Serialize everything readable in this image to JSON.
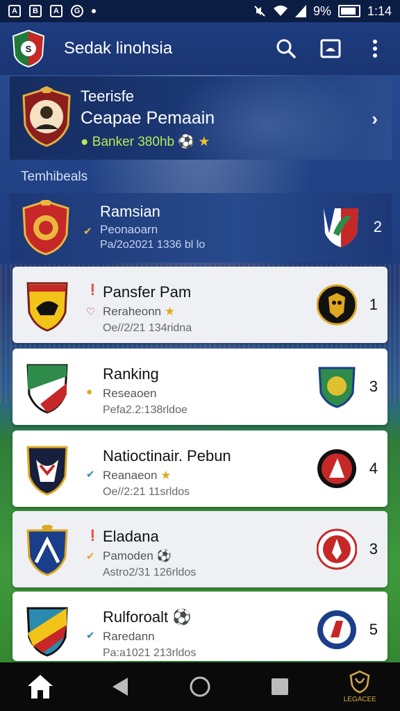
{
  "status_bar": {
    "battery": "9%",
    "time": "1:14",
    "icons": [
      "app-a-icon",
      "app-b-icon",
      "app-c-icon",
      "app-d-icon",
      "dot-icon",
      "mute-icon",
      "wifi-icon",
      "signal-icon",
      "battery-icon"
    ]
  },
  "app_bar": {
    "title": "Sedak linohsia",
    "icons": [
      "search-icon",
      "screen-icon",
      "more-vert-icon"
    ]
  },
  "featured": {
    "line1": "Teerisfe",
    "line2": "Ceapae Pemaain",
    "line3": "Banker 380hb",
    "chevron": "›"
  },
  "section": {
    "label": "Temhibeals"
  },
  "rows": [
    {
      "title": "Ramsian",
      "subtitle": "Peonaoarn",
      "date": "Pa/2o2021 1336 bl lo",
      "number": "2",
      "variant": "top"
    },
    {
      "title": "Pansfer Pam",
      "subtitle": "Reraheonn",
      "date": "Oe//2/21 134ridna",
      "number": "1",
      "variant": "alt"
    },
    {
      "title": "Ranking",
      "subtitle": "Reseaoen",
      "date": "Pefa2.2:138rldoe",
      "number": "3",
      "variant": "plain"
    },
    {
      "title": "Natioctinair. Pebun",
      "subtitle": "Reanaeon",
      "date": "Oe//2:21 11srldos",
      "number": "4",
      "variant": "plain"
    },
    {
      "title": "Eladana",
      "subtitle": "Pamoden",
      "date": "Astro2/31 126rldos",
      "number": "3",
      "variant": "alt"
    },
    {
      "title": "Rulforoalt",
      "subtitle": "Raredann",
      "date": "Pa:a1021 213rldos",
      "number": "5",
      "variant": "plain"
    }
  ],
  "nav": {
    "brand_label": "LEGACEE",
    "icons": [
      "home-icon",
      "back-icon",
      "home-circle-icon",
      "recents-icon",
      "brand-icon"
    ]
  },
  "colors": {
    "app_bar": "#1e3c80",
    "accent_green": "#b8e85a",
    "row_bg": "#ffffff",
    "nav_bg": "#0a0a0a"
  }
}
